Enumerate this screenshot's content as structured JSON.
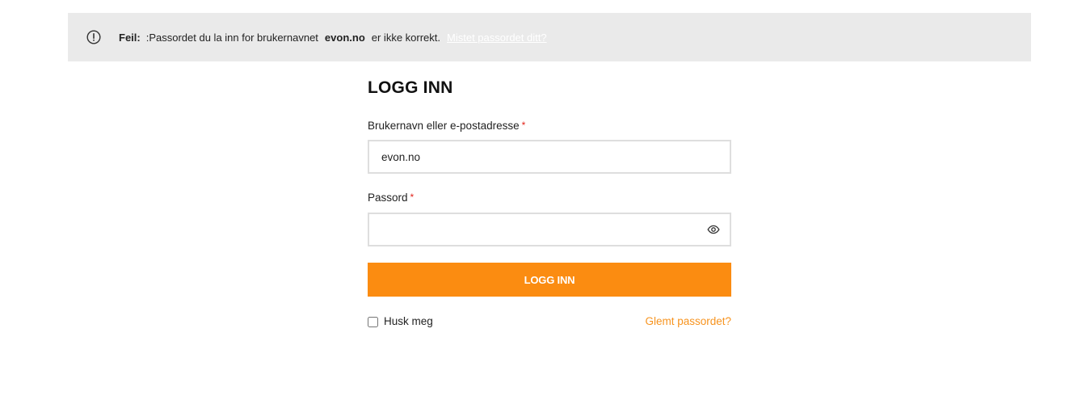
{
  "notice": {
    "icon": "alert-circle-icon",
    "label": "Feil:",
    "message_before": ":Passordet du la inn for brukernavnet",
    "username": "evon.no",
    "message_after": "er ikke korrekt.",
    "lost_password_link": "Mistet passordet ditt?"
  },
  "login": {
    "title": "LOGG INN",
    "username_label": "Brukernavn eller e-postadresse",
    "required_marker": "*",
    "username_value": "evon.no",
    "password_label": "Passord",
    "password_value": "",
    "show_password_icon": "eye-icon",
    "submit_label": "LOGG INN",
    "remember_label": "Husk meg",
    "remember_checked": false,
    "forgot_label": "Glemt passordet?"
  },
  "colors": {
    "accent": "#fb8c11",
    "link": "#f7931e",
    "notice_bg": "#eaeaea",
    "required": "#e2231a"
  }
}
